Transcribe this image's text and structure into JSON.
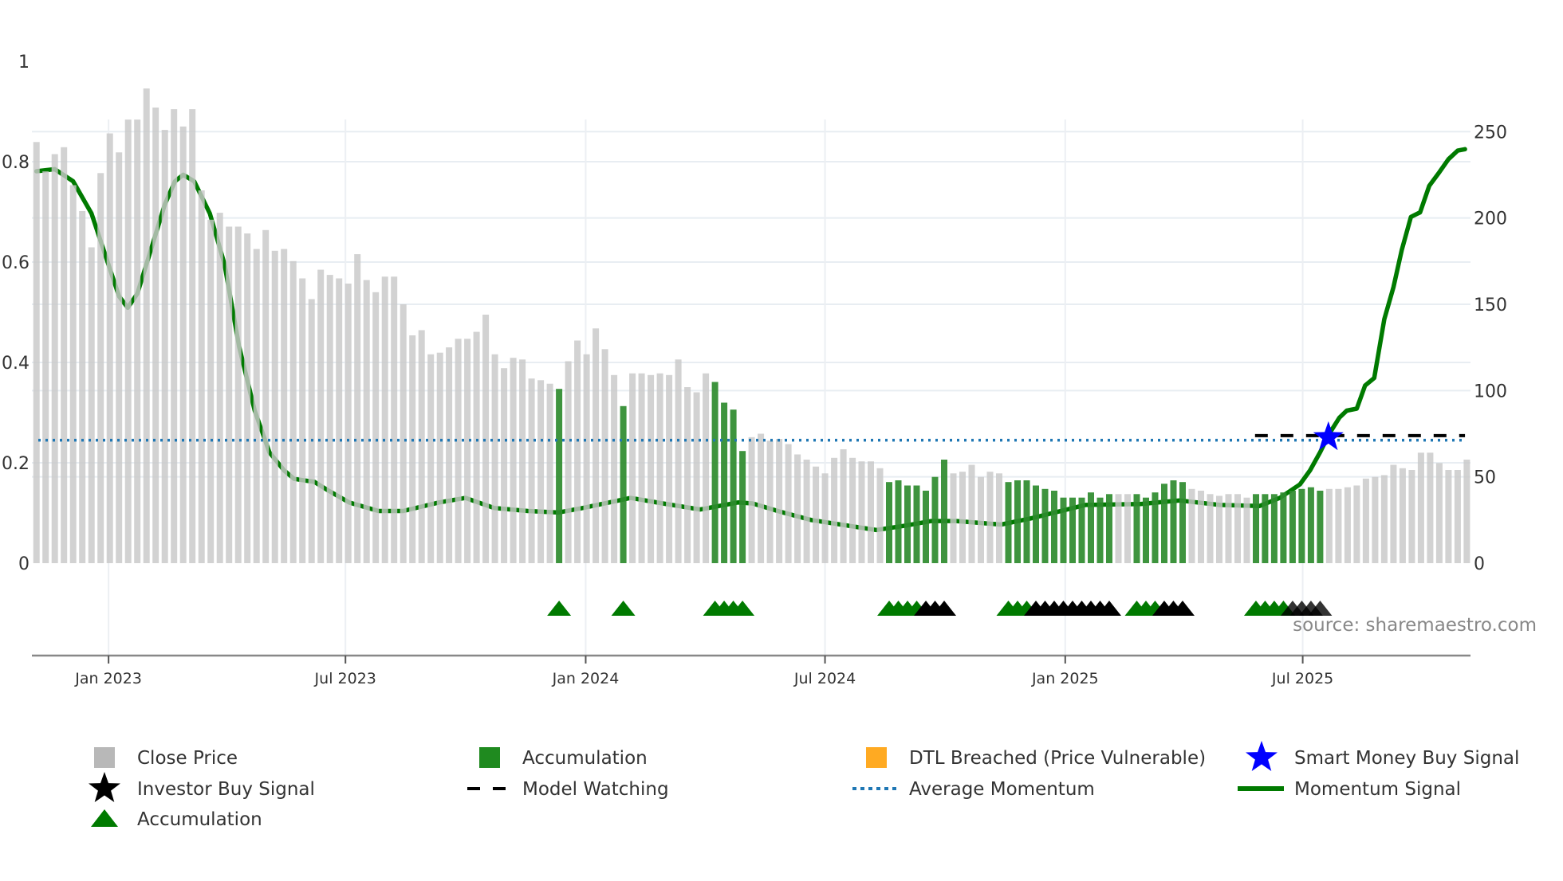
{
  "chart_data": {
    "type": "bar",
    "title": "",
    "x_unit": "week index",
    "xlim": [
      -0.5,
      156.4
    ],
    "x_ticks": [
      {
        "label": "Jan 2023",
        "x": 7.86
      },
      {
        "label": "Jul 2023",
        "x": 33.7
      },
      {
        "label": "Jan 2024",
        "x": 59.9
      },
      {
        "label": "Jul 2024",
        "x": 86.0
      },
      {
        "label": "Jan 2025",
        "x": 112.2
      },
      {
        "label": "Jul 2025",
        "x": 138.1
      }
    ],
    "left_axis": {
      "ylim": [
        0,
        1
      ],
      "ticks": [
        {
          "v": 0,
          "label": "0"
        },
        {
          "v": 0.2,
          "label": "0.2"
        },
        {
          "v": 0.4,
          "label": "0.4"
        },
        {
          "v": 0.6,
          "label": "0.6"
        },
        {
          "v": 0.8,
          "label": "0.8"
        },
        {
          "v": 1,
          "label": "1"
        }
      ]
    },
    "right_axis": {
      "ylim": [
        0,
        250
      ],
      "ticks": [
        {
          "v": 0,
          "label": "0"
        },
        {
          "v": 50,
          "label": "50"
        },
        {
          "v": 100,
          "label": "100"
        },
        {
          "v": 150,
          "label": "150"
        },
        {
          "v": 200,
          "label": "200"
        },
        {
          "v": 250,
          "label": "250"
        }
      ]
    },
    "grid": true,
    "close_price": [
      244,
      227,
      237,
      241,
      219,
      204,
      183,
      226,
      249,
      238,
      257,
      257,
      275,
      264,
      251,
      263,
      253,
      263,
      216,
      199,
      203,
      195,
      195,
      191,
      182,
      193,
      181,
      182,
      175,
      165,
      153,
      170,
      167,
      165,
      162,
      179,
      164,
      157,
      166,
      166,
      150,
      132,
      135,
      121,
      122,
      125,
      130,
      130,
      134,
      144,
      121,
      113,
      119,
      118,
      107,
      106,
      104,
      101,
      117,
      129,
      121,
      136,
      124,
      109,
      91,
      110,
      110,
      109,
      110,
      109,
      118,
      102,
      99,
      110,
      105,
      93,
      89,
      65,
      73,
      75,
      71,
      72,
      69,
      63,
      60,
      56,
      52,
      61,
      66,
      61,
      59,
      59,
      55,
      47,
      48,
      45,
      45,
      42,
      50,
      60,
      52,
      53,
      57,
      50,
      53,
      52,
      47,
      48,
      48,
      45,
      43,
      42,
      38,
      38,
      38,
      41,
      38,
      40,
      40,
      40,
      40,
      38,
      41,
      46,
      48,
      47,
      43,
      42,
      40,
      39,
      40,
      40,
      38,
      40,
      40,
      40,
      41,
      42,
      43,
      44,
      42,
      43,
      43,
      44,
      45,
      49,
      50,
      51,
      57,
      55,
      54,
      64,
      64,
      58,
      54,
      54,
      60
    ],
    "accumulation_weeks": [
      57,
      64,
      74,
      75,
      76,
      77,
      93,
      94,
      95,
      96,
      97,
      98,
      99,
      106,
      107,
      108,
      109,
      110,
      111,
      112,
      113,
      114,
      115,
      116,
      117,
      120,
      121,
      122,
      123,
      124,
      125,
      133,
      134,
      135,
      136,
      137,
      138,
      139,
      140
    ],
    "accumulation_triangles_green": [
      57,
      64,
      74,
      75,
      76,
      77,
      93,
      94,
      95,
      96,
      106,
      107,
      108,
      120,
      121,
      122,
      133,
      134,
      135,
      136
    ],
    "accumulation_triangles_black": [
      97,
      98,
      99,
      109,
      110,
      111,
      112,
      113,
      114,
      115,
      116,
      117,
      123,
      124,
      125,
      137,
      138,
      139,
      140
    ],
    "momentum_signal": [
      [
        0,
        0.781
      ],
      [
        2,
        0.785
      ],
      [
        4,
        0.761
      ],
      [
        6,
        0.697
      ],
      [
        8,
        0.587
      ],
      [
        9,
        0.532
      ],
      [
        9.95,
        0.509
      ],
      [
        11,
        0.537
      ],
      [
        12.3,
        0.614
      ],
      [
        14,
        0.715
      ],
      [
        15.1,
        0.761
      ],
      [
        16,
        0.774
      ],
      [
        17.2,
        0.761
      ],
      [
        18.9,
        0.697
      ],
      [
        20.5,
        0.596
      ],
      [
        22.1,
        0.432
      ],
      [
        23.8,
        0.304
      ],
      [
        25.4,
        0.221
      ],
      [
        27,
        0.185
      ],
      [
        28.1,
        0.168
      ],
      [
        30.3,
        0.162
      ],
      [
        31.9,
        0.144
      ],
      [
        34.1,
        0.121
      ],
      [
        37.3,
        0.104
      ],
      [
        40,
        0.104
      ],
      [
        43.9,
        0.121
      ],
      [
        46.8,
        0.13
      ],
      [
        49.9,
        0.11
      ],
      [
        53.6,
        0.104
      ],
      [
        56.9,
        0.101
      ],
      [
        59.6,
        0.11
      ],
      [
        64.8,
        0.13
      ],
      [
        68.3,
        0.119
      ],
      [
        72.4,
        0.107
      ],
      [
        76.5,
        0.121
      ],
      [
        78.1,
        0.119
      ],
      [
        81.2,
        0.102
      ],
      [
        84.5,
        0.086
      ],
      [
        91.6,
        0.066
      ],
      [
        94.8,
        0.075
      ],
      [
        97.6,
        0.084
      ],
      [
        100.3,
        0.084
      ],
      [
        105.2,
        0.077
      ],
      [
        108.4,
        0.089
      ],
      [
        114.4,
        0.116
      ],
      [
        120.4,
        0.118
      ],
      [
        124.7,
        0.125
      ],
      [
        129.1,
        0.116
      ],
      [
        133.4,
        0.114
      ],
      [
        135.6,
        0.13
      ],
      [
        137.8,
        0.157
      ],
      [
        138.9,
        0.185
      ],
      [
        140,
        0.221
      ],
      [
        141,
        0.258
      ],
      [
        142.1,
        0.29
      ],
      [
        142.9,
        0.304
      ],
      [
        144,
        0.308
      ],
      [
        144.9,
        0.354
      ],
      [
        145.9,
        0.369
      ],
      [
        147,
        0.486
      ],
      [
        148,
        0.55
      ],
      [
        148.9,
        0.624
      ],
      [
        149.9,
        0.69
      ],
      [
        150.9,
        0.699
      ],
      [
        151.9,
        0.752
      ],
      [
        153,
        0.779
      ],
      [
        154,
        0.805
      ],
      [
        155,
        0.822
      ],
      [
        155.8,
        0.825
      ]
    ],
    "average_momentum": 0.245,
    "model_watching": {
      "from": 132.9,
      "to": 155.8,
      "value": 0.251
    },
    "smart_money_buy_signal": {
      "x": 140.9,
      "value": 0.251
    },
    "colors": {
      "close_price": "#c8c8c8",
      "accumulation": "#2e8b2e",
      "dtl": "#ffaa22",
      "smart_money": "#0000ff",
      "momentum": "#007a00",
      "average": "#1f77b4",
      "watching": "#000000"
    },
    "legend": [
      {
        "key": "close_price",
        "label": "Close Price",
        "icon": "square",
        "color": "#b8b8b8"
      },
      {
        "key": "accumulation_bar",
        "label": "Accumulation",
        "icon": "square",
        "color": "#1f8a1f"
      },
      {
        "key": "dtl",
        "label": "DTL Breached (Price Vulnerable)",
        "icon": "square",
        "color": "#ffaa22"
      },
      {
        "key": "smart_money",
        "label": "Smart Money Buy Signal",
        "icon": "star",
        "color": "#0000ff"
      },
      {
        "key": "investor_buy",
        "label": "Investor Buy Signal",
        "icon": "star",
        "color": "#000000"
      },
      {
        "key": "model_watching",
        "label": "Model Watching",
        "icon": "dash",
        "color": "#000000"
      },
      {
        "key": "average_momentum",
        "label": "Average Momentum",
        "icon": "dot",
        "color": "#1f77b4"
      },
      {
        "key": "momentum_signal",
        "label": "Momentum Signal",
        "icon": "line",
        "color": "#007a00"
      },
      {
        "key": "accumulation_triangle",
        "label": "Accumulation",
        "icon": "triangle",
        "color": "#007a00"
      }
    ],
    "source": "source: sharemaestro.com"
  }
}
